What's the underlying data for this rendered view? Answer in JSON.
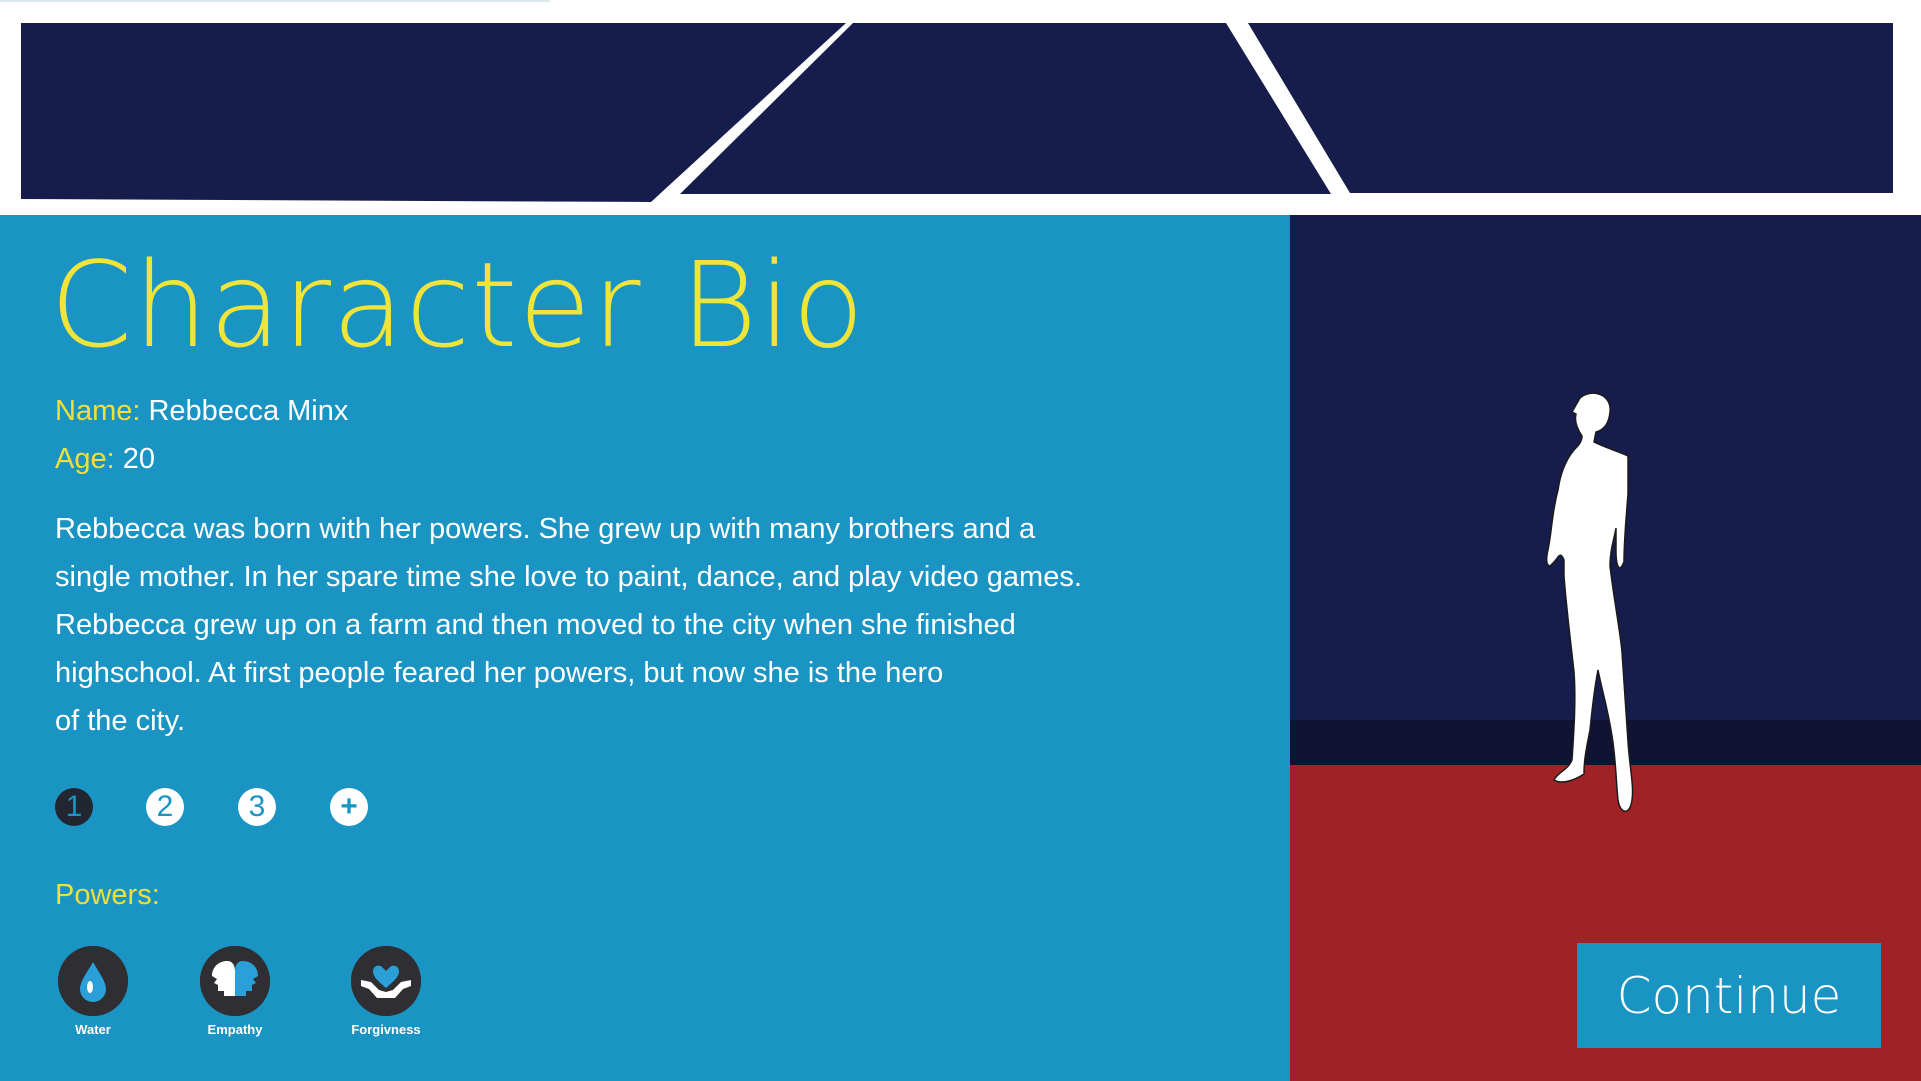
{
  "screen": {
    "title": "Character Bio"
  },
  "character": {
    "name_label": "Name:",
    "name": "Rebbecca Minx",
    "age_label": "Age:",
    "age": "20",
    "bio_lines": [
      "Rebbecca was born with her powers. She grew up with many brothers and a",
      "single mother. In her spare time she love to paint, dance, and play video games.",
      "Rebbecca grew up on a farm and then moved to the city when she finished",
      "highschool. At first people feared her powers, but now she is the hero",
      "of the city."
    ]
  },
  "pager": {
    "pages": [
      "1",
      "2",
      "3"
    ],
    "add_label": "+",
    "active_page": 1
  },
  "powers": {
    "label": "Powers:",
    "items": [
      {
        "name": "Water",
        "icon": "water-drop-icon"
      },
      {
        "name": "Empathy",
        "icon": "two-heads-icon"
      },
      {
        "name": "Forgivness",
        "icon": "heart-in-hands-icon"
      }
    ]
  },
  "actions": {
    "continue_label": "Continue"
  },
  "colors": {
    "panel": "#1a94c2",
    "banner_navy": "#161c4b",
    "title_yellow": "#f0e43a",
    "floor_red": "#9f2326",
    "icon_dark": "#2e2e33"
  }
}
